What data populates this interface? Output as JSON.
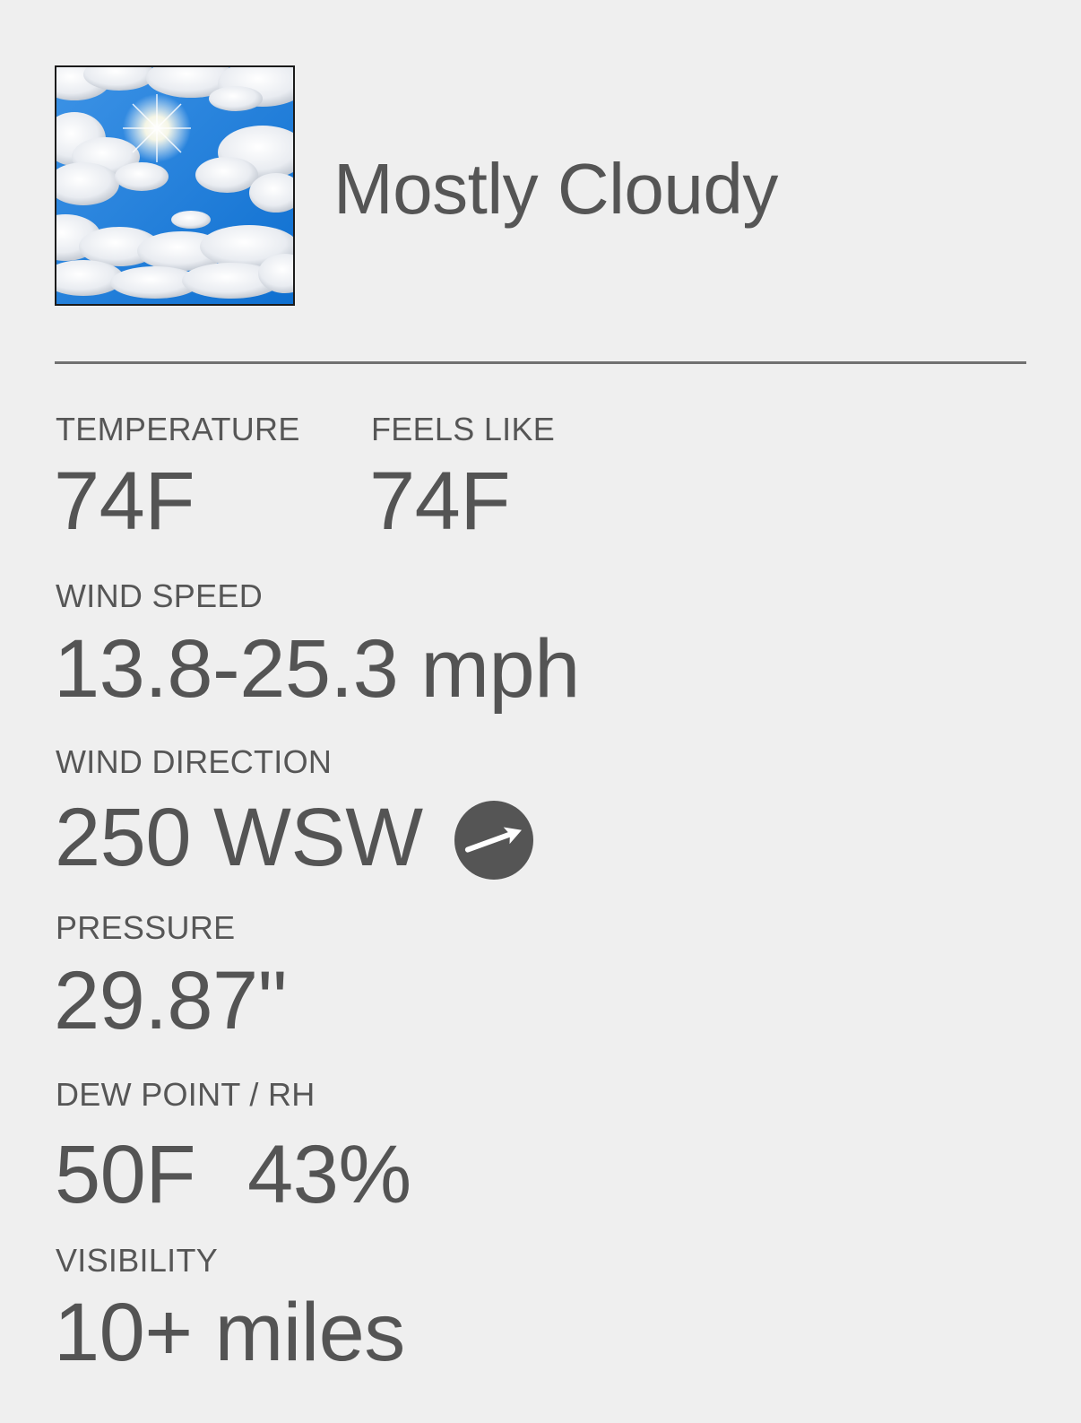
{
  "current": {
    "condition": "Mostly Cloudy",
    "condition_icon": "mostly-cloudy-sky-image"
  },
  "metrics": {
    "temperature": {
      "label": "TEMPERATURE",
      "value": "74F"
    },
    "feels_like": {
      "label": "FEELS LIKE",
      "value": "74F"
    },
    "wind_speed": {
      "label": "WIND SPEED",
      "value": "13.8-25.3 mph"
    },
    "wind_direction": {
      "label": "WIND DIRECTION",
      "value": "250 WSW",
      "icon": "wind-direction-arrow-icon"
    },
    "pressure": {
      "label": "PRESSURE",
      "value": "29.87\""
    },
    "dew_point_rh": {
      "label": "DEW POINT / RH",
      "dew_point": "50F",
      "rh": "43%"
    },
    "visibility": {
      "label": "VISIBILITY",
      "value": "10+ miles"
    }
  },
  "colors": {
    "background": "#efefef",
    "text": "#545454",
    "divider": "#707070",
    "compass": "#555555",
    "sky_blue": "#1f7fd6"
  }
}
